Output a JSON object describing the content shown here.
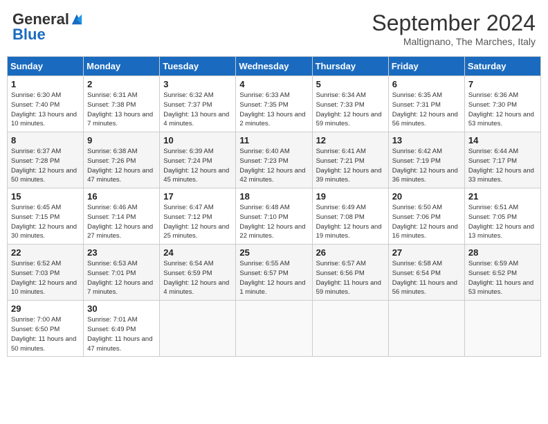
{
  "header": {
    "logo_general": "General",
    "logo_blue": "Blue",
    "month_title": "September 2024",
    "subtitle": "Maltignano, The Marches, Italy"
  },
  "weekdays": [
    "Sunday",
    "Monday",
    "Tuesday",
    "Wednesday",
    "Thursday",
    "Friday",
    "Saturday"
  ],
  "weeks": [
    [
      {
        "day": "1",
        "sunrise": "6:30 AM",
        "sunset": "7:40 PM",
        "daylight": "13 hours and 10 minutes."
      },
      {
        "day": "2",
        "sunrise": "6:31 AM",
        "sunset": "7:38 PM",
        "daylight": "13 hours and 7 minutes."
      },
      {
        "day": "3",
        "sunrise": "6:32 AM",
        "sunset": "7:37 PM",
        "daylight": "13 hours and 4 minutes."
      },
      {
        "day": "4",
        "sunrise": "6:33 AM",
        "sunset": "7:35 PM",
        "daylight": "13 hours and 2 minutes."
      },
      {
        "day": "5",
        "sunrise": "6:34 AM",
        "sunset": "7:33 PM",
        "daylight": "12 hours and 59 minutes."
      },
      {
        "day": "6",
        "sunrise": "6:35 AM",
        "sunset": "7:31 PM",
        "daylight": "12 hours and 56 minutes."
      },
      {
        "day": "7",
        "sunrise": "6:36 AM",
        "sunset": "7:30 PM",
        "daylight": "12 hours and 53 minutes."
      }
    ],
    [
      {
        "day": "8",
        "sunrise": "6:37 AM",
        "sunset": "7:28 PM",
        "daylight": "12 hours and 50 minutes."
      },
      {
        "day": "9",
        "sunrise": "6:38 AM",
        "sunset": "7:26 PM",
        "daylight": "12 hours and 47 minutes."
      },
      {
        "day": "10",
        "sunrise": "6:39 AM",
        "sunset": "7:24 PM",
        "daylight": "12 hours and 45 minutes."
      },
      {
        "day": "11",
        "sunrise": "6:40 AM",
        "sunset": "7:23 PM",
        "daylight": "12 hours and 42 minutes."
      },
      {
        "day": "12",
        "sunrise": "6:41 AM",
        "sunset": "7:21 PM",
        "daylight": "12 hours and 39 minutes."
      },
      {
        "day": "13",
        "sunrise": "6:42 AM",
        "sunset": "7:19 PM",
        "daylight": "12 hours and 36 minutes."
      },
      {
        "day": "14",
        "sunrise": "6:44 AM",
        "sunset": "7:17 PM",
        "daylight": "12 hours and 33 minutes."
      }
    ],
    [
      {
        "day": "15",
        "sunrise": "6:45 AM",
        "sunset": "7:15 PM",
        "daylight": "12 hours and 30 minutes."
      },
      {
        "day": "16",
        "sunrise": "6:46 AM",
        "sunset": "7:14 PM",
        "daylight": "12 hours and 27 minutes."
      },
      {
        "day": "17",
        "sunrise": "6:47 AM",
        "sunset": "7:12 PM",
        "daylight": "12 hours and 25 minutes."
      },
      {
        "day": "18",
        "sunrise": "6:48 AM",
        "sunset": "7:10 PM",
        "daylight": "12 hours and 22 minutes."
      },
      {
        "day": "19",
        "sunrise": "6:49 AM",
        "sunset": "7:08 PM",
        "daylight": "12 hours and 19 minutes."
      },
      {
        "day": "20",
        "sunrise": "6:50 AM",
        "sunset": "7:06 PM",
        "daylight": "12 hours and 16 minutes."
      },
      {
        "day": "21",
        "sunrise": "6:51 AM",
        "sunset": "7:05 PM",
        "daylight": "12 hours and 13 minutes."
      }
    ],
    [
      {
        "day": "22",
        "sunrise": "6:52 AM",
        "sunset": "7:03 PM",
        "daylight": "12 hours and 10 minutes."
      },
      {
        "day": "23",
        "sunrise": "6:53 AM",
        "sunset": "7:01 PM",
        "daylight": "12 hours and 7 minutes."
      },
      {
        "day": "24",
        "sunrise": "6:54 AM",
        "sunset": "6:59 PM",
        "daylight": "12 hours and 4 minutes."
      },
      {
        "day": "25",
        "sunrise": "6:55 AM",
        "sunset": "6:57 PM",
        "daylight": "12 hours and 1 minute."
      },
      {
        "day": "26",
        "sunrise": "6:57 AM",
        "sunset": "6:56 PM",
        "daylight": "11 hours and 59 minutes."
      },
      {
        "day": "27",
        "sunrise": "6:58 AM",
        "sunset": "6:54 PM",
        "daylight": "11 hours and 56 minutes."
      },
      {
        "day": "28",
        "sunrise": "6:59 AM",
        "sunset": "6:52 PM",
        "daylight": "11 hours and 53 minutes."
      }
    ],
    [
      {
        "day": "29",
        "sunrise": "7:00 AM",
        "sunset": "6:50 PM",
        "daylight": "11 hours and 50 minutes."
      },
      {
        "day": "30",
        "sunrise": "7:01 AM",
        "sunset": "6:49 PM",
        "daylight": "11 hours and 47 minutes."
      },
      null,
      null,
      null,
      null,
      null
    ]
  ]
}
